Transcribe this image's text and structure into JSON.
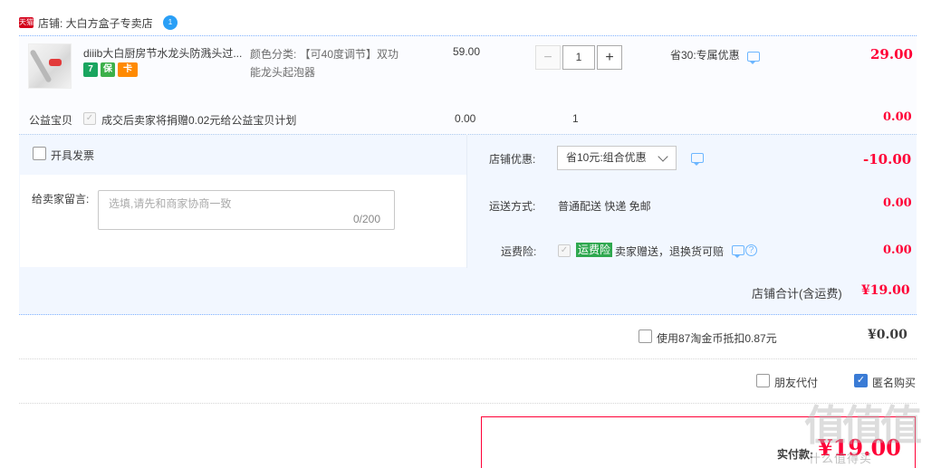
{
  "shop": {
    "badge": "天猫",
    "label": "店铺: 大白方盒子专卖店",
    "ww_icon": "1"
  },
  "item": {
    "title": "diiib大白厨房节水龙头防溅头过...",
    "sku_line1": "颜色分类: 【可40度调节】双功",
    "sku_line2": "能龙头起泡器",
    "price": "59.00",
    "qty_minus": "−",
    "qty": "1",
    "qty_plus": "+",
    "promo": "省30:专属优惠",
    "subtotal": "29.00",
    "service_icons": [
      "7",
      "保",
      "卡"
    ]
  },
  "charity": {
    "label": "公益宝贝",
    "check": "✓",
    "text": "成交后卖家将捐赠0.02元给公益宝贝计划",
    "price": "0.00",
    "qty": "1",
    "total": "0.00"
  },
  "invoice": {
    "label": "开具发票"
  },
  "message": {
    "label": "给卖家留言:",
    "placeholder": "选填,请先和商家协商一致",
    "count": "0/200"
  },
  "coupon": {
    "label": "店铺优惠:",
    "value": "省10元:组合优惠",
    "amount": "-10.00"
  },
  "shipping": {
    "label": "运送方式:",
    "value": "普通配送 快递 免邮",
    "amount": "0.00"
  },
  "insurance": {
    "label": "运费险:",
    "check": "✓",
    "tag": "运费险",
    "text": "卖家赠送，退换货可赔",
    "help": "?",
    "amount": "0.00"
  },
  "shop_total": {
    "label": "店铺合计(含运费)",
    "value": "¥19.00"
  },
  "coins": {
    "label": "使用87淘金币抵扣0.87元",
    "value": "¥0.00"
  },
  "options": {
    "friend_pay": "朋友代付",
    "anonymous_check": "✓",
    "anonymous": "匿名购买"
  },
  "payment": {
    "label": "实付款:",
    "value": "¥19.00"
  },
  "watermark": {
    "big": "值值值",
    "small": "什么值得买"
  },
  "colors": {
    "accent_red": "#ff0036",
    "panel_blue": "#f2f7ff",
    "link_blue": "#6cb6ff",
    "insurance_green": "#2fa84f",
    "check_blue": "#3a7bd5"
  }
}
